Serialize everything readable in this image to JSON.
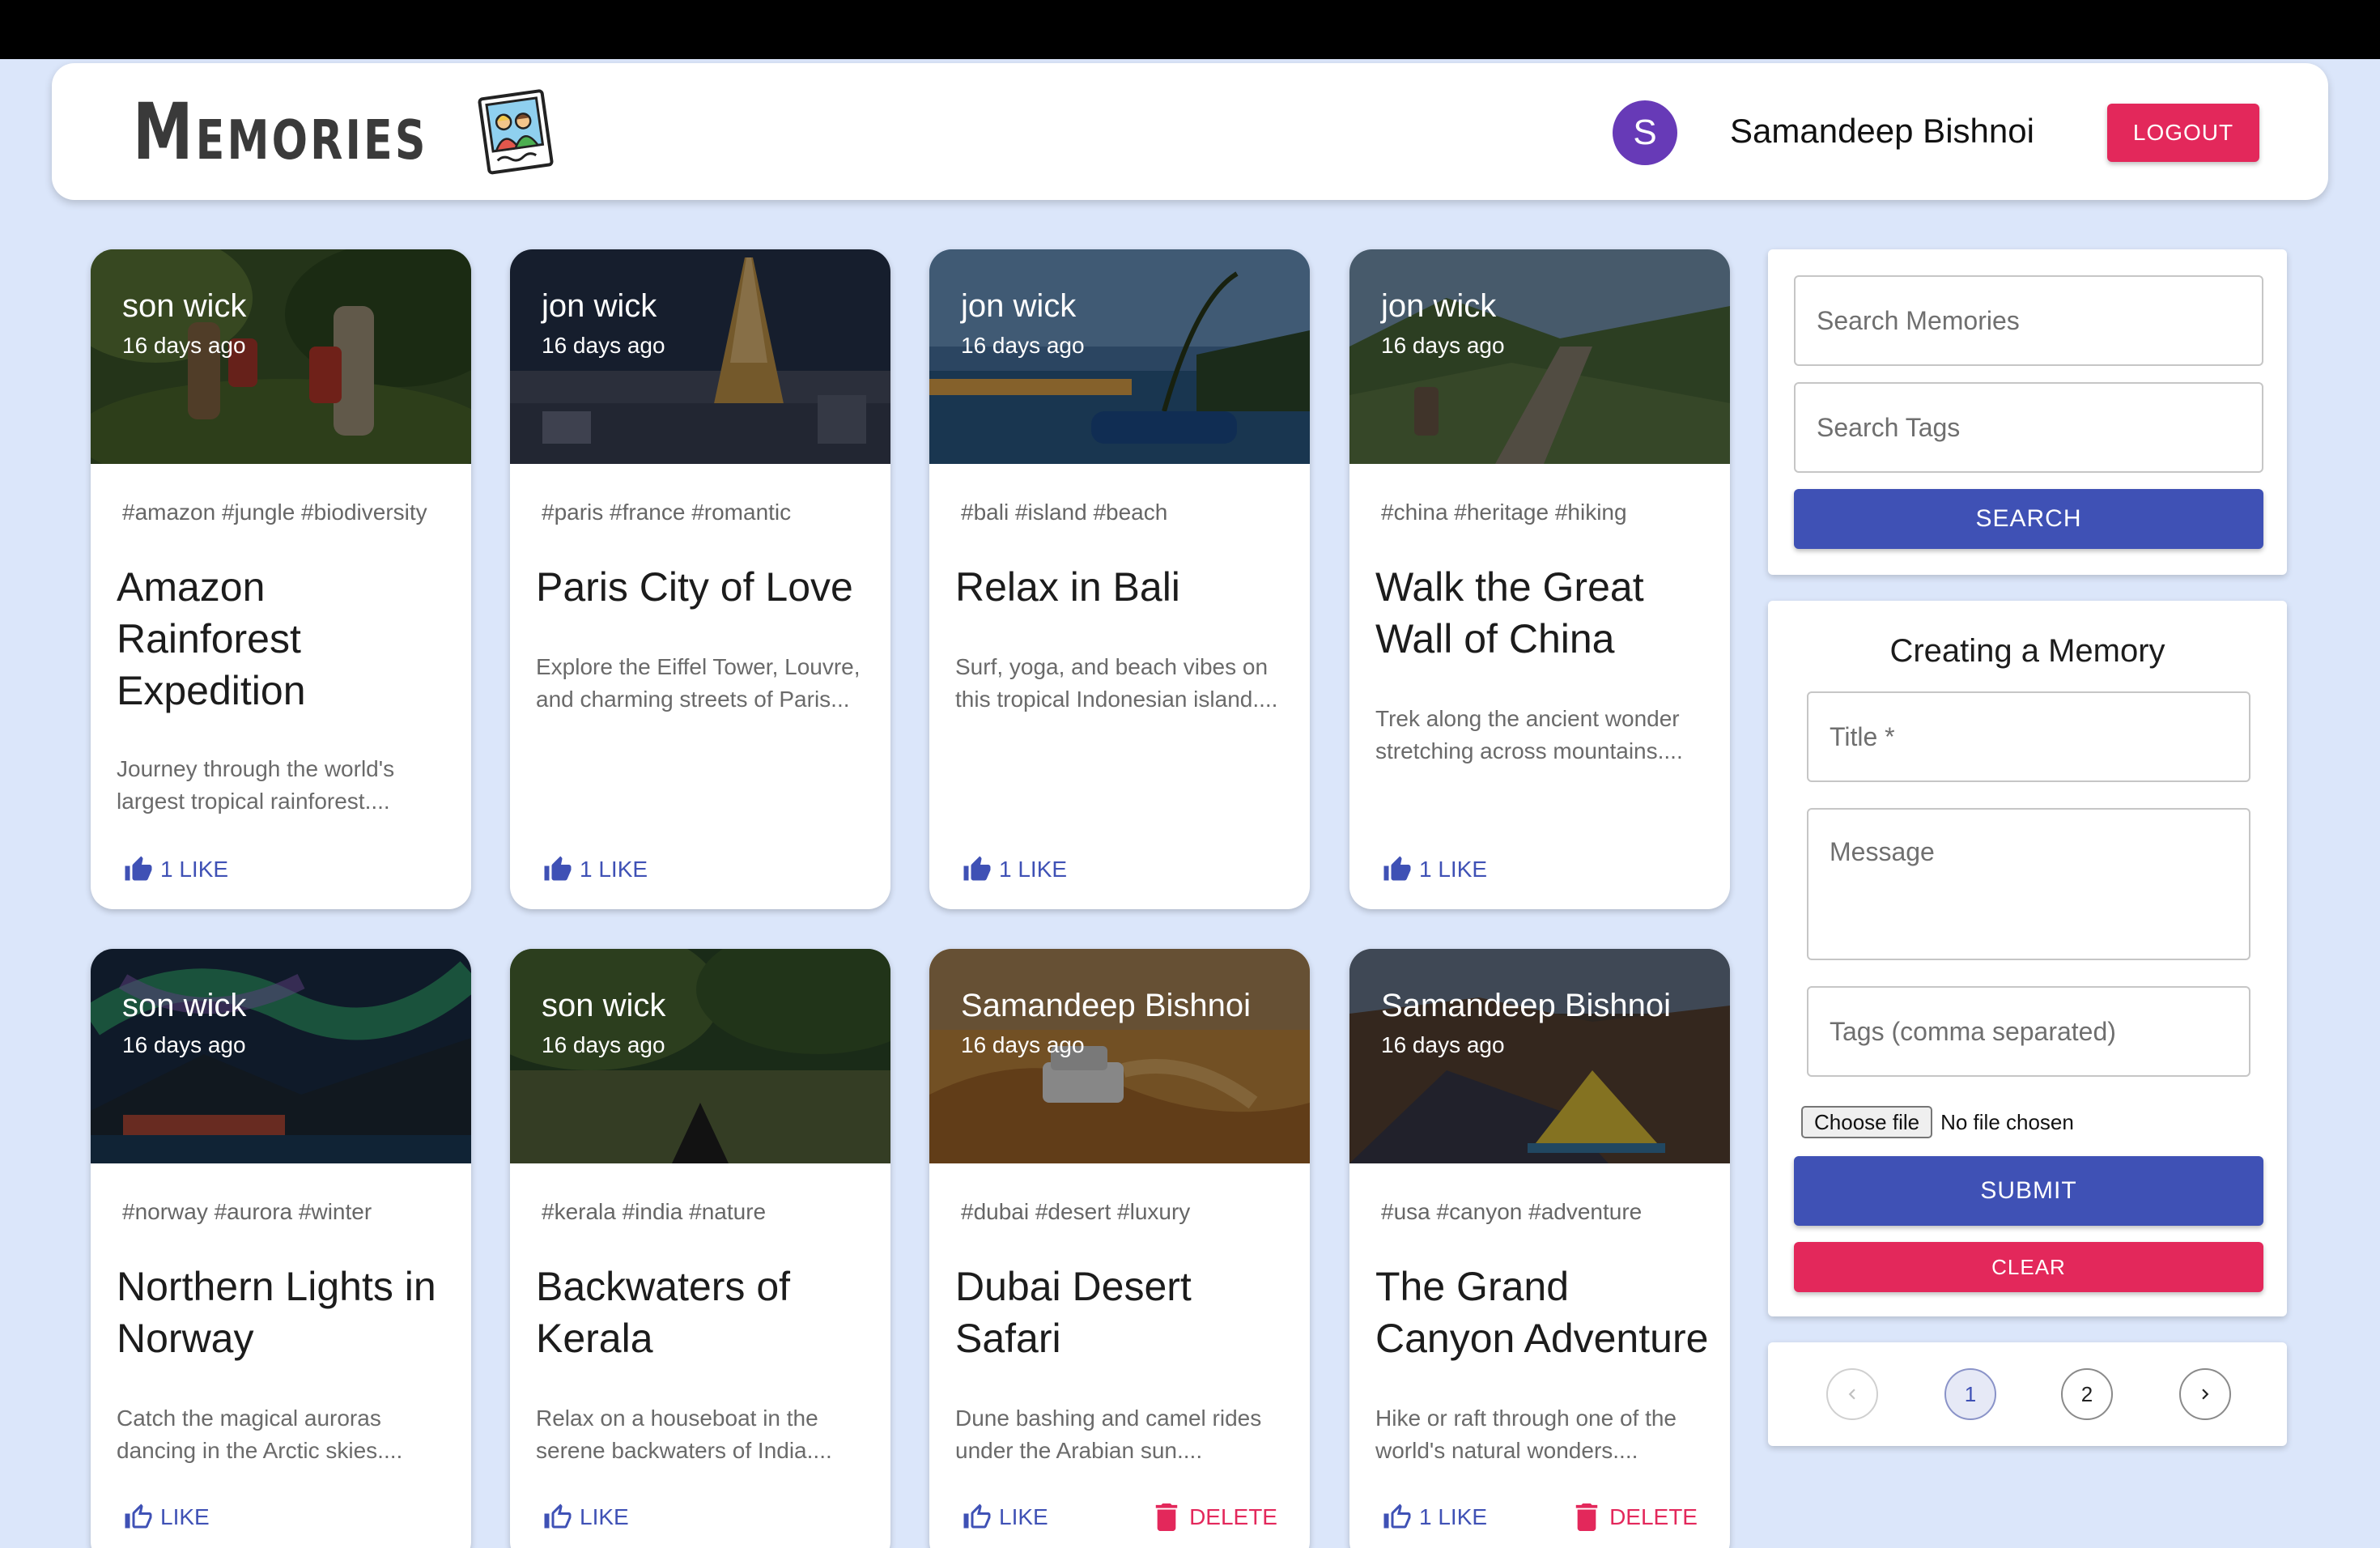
{
  "header": {
    "brand_title": "Memories",
    "avatar_letter": "S",
    "user_name": "Samandeep Bishnoi",
    "logout_label": "LOGOUT"
  },
  "posts": [
    {
      "author": "son wick",
      "time": "16 days ago",
      "tags": "#amazon #jungle #biodiversity",
      "title": "Amazon Rainforest Expedition",
      "message": "Journey through the world's largest tropical rainforest....",
      "like_label": "1 LIKE"
    },
    {
      "author": "jon wick",
      "time": "16 days ago",
      "tags": "#paris #france #romantic",
      "title": "Paris City of Love",
      "message": "Explore the Eiffel Tower, Louvre, and charming streets of Paris...",
      "like_label": "1 LIKE"
    },
    {
      "author": "jon wick",
      "time": "16 days ago",
      "tags": "#bali #island #beach",
      "title": "Relax in Bali",
      "message": "Surf, yoga, and beach vibes on this tropical Indonesian island....",
      "like_label": "1 LIKE"
    },
    {
      "author": "jon wick",
      "time": "16 days ago",
      "tags": "#china #heritage #hiking",
      "title": "Walk the Great Wall of China",
      "message": "Trek along the ancient wonder stretching across mountains....",
      "like_label": "1 LIKE"
    },
    {
      "author": "son wick",
      "time": "16 days ago",
      "tags": "#norway #aurora #winter",
      "title": "Northern Lights in Norway",
      "message": "Catch the magical auroras dancing in the Arctic skies....",
      "like_label": "LIKE"
    },
    {
      "author": "son wick",
      "time": "16 days ago",
      "tags": "#kerala #india #nature",
      "title": "Backwaters of Kerala",
      "message": "Relax on a houseboat in the serene backwaters of India....",
      "like_label": "LIKE"
    },
    {
      "author": "Samandeep Bishnoi",
      "time": "16 days ago",
      "tags": "#dubai #desert #luxury",
      "title": "Dubai Desert Safari",
      "message": "Dune bashing and camel rides under the Arabian sun....",
      "like_label": "LIKE",
      "delete_label": "DELETE"
    },
    {
      "author": "Samandeep Bishnoi",
      "time": "16 days ago",
      "tags": "#usa #canyon #adventure",
      "title": "The Grand Canyon Adventure",
      "message": "Hike or raft through one of the world's natural wonders....",
      "like_label": "1 LIKE",
      "delete_label": "DELETE"
    }
  ],
  "search": {
    "memories_placeholder": "Search Memories",
    "tags_placeholder": "Search Tags",
    "button_label": "SEARCH"
  },
  "form": {
    "title": "Creating a Memory",
    "title_placeholder": "Title *",
    "message_placeholder": "Message",
    "tags_placeholder": "Tags (comma separated)",
    "file_button_label": "Choose file",
    "file_status": "No file chosen",
    "submit_label": "SUBMIT",
    "clear_label": "CLEAR"
  },
  "pagination": {
    "pages": [
      "1",
      "2"
    ],
    "current_page": "1"
  },
  "colors": {
    "primary": "#3f51b5",
    "secondary": "#e3285b",
    "avatar": "#673ab7",
    "background": "#dbe6fa"
  }
}
